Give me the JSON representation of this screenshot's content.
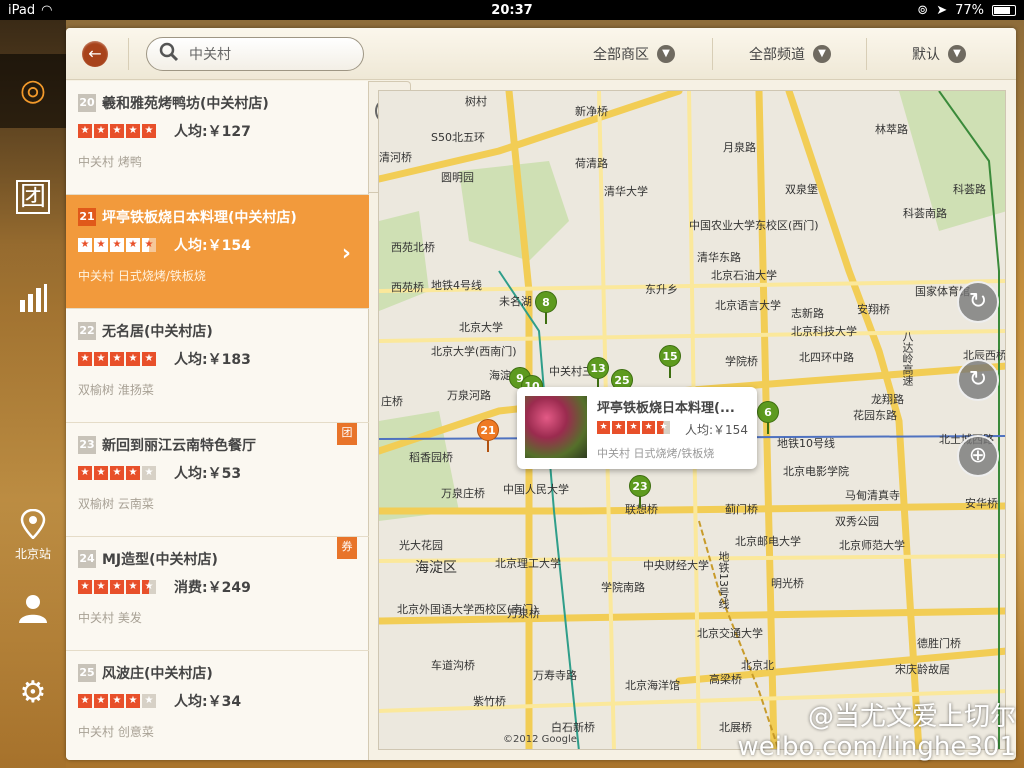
{
  "status": {
    "device": "iPad",
    "time": "20:37",
    "battery": "77%"
  },
  "rail": {
    "items": [
      {
        "icon": "search-map-icon",
        "glyph": "◎",
        "label": ""
      },
      {
        "icon": "group-buy-icon",
        "glyph": "团",
        "label": ""
      },
      {
        "icon": "chart-icon",
        "glyph": "▮",
        "label": ""
      },
      {
        "icon": "location-pin-icon",
        "glyph": "⌾",
        "label": "北京站"
      },
      {
        "icon": "user-icon",
        "glyph": "☻",
        "label": ""
      },
      {
        "icon": "gear-icon",
        "glyph": "⚙",
        "label": ""
      }
    ]
  },
  "topbar": {
    "search_value": "中关村",
    "filters": [
      "全部商区",
      "全部频道",
      "默认"
    ]
  },
  "list": [
    {
      "num": "20",
      "name": "羲和雅苑烤鸭坊(中关村店)",
      "stars": 5,
      "price": "人均:￥127",
      "tags": "中关村  烤鸭",
      "badge": ""
    },
    {
      "num": "21",
      "name": "坪亭铁板烧日本料理(中关村店)",
      "stars": 4.5,
      "price": "人均:￥154",
      "tags": "中关村  日式烧烤/铁板烧",
      "badge": ""
    },
    {
      "num": "22",
      "name": "无名居(中关村店)",
      "stars": 5,
      "price": "人均:￥183",
      "tags": "双榆树  淮扬菜",
      "badge": ""
    },
    {
      "num": "23",
      "name": "新回到丽江云南特色餐厅",
      "stars": 4,
      "price": "人均:￥53",
      "tags": "双榆树  云南菜",
      "badge": "团"
    },
    {
      "num": "24",
      "name": "MJ造型(中关村店)",
      "stars": 4.5,
      "price": "消费:￥249",
      "tags": "中关村  美发",
      "badge": "券"
    },
    {
      "num": "25",
      "name": "风波庄(中关村店)",
      "stars": 4,
      "price": "人均:￥34",
      "tags": "中关村  创意菜",
      "badge": ""
    }
  ],
  "map": {
    "labels": [
      "树村",
      "新净桥",
      "S50北五环",
      "圆明园",
      "清河桥",
      "荷清路",
      "清华大学",
      "月泉路",
      "双泉堡",
      "林萃路",
      "科荟路",
      "西苑北桥",
      "中国农业大学东校区(西门)",
      "清华东路",
      "科荟南路",
      "西苑桥",
      "地铁4号线",
      "未名湖",
      "东升乡",
      "北京石油大学",
      "北京语言大学",
      "北京大学",
      "志新路",
      "安翔桥",
      "国家体育馆",
      "北京大学(西南门)",
      "中关村三",
      "学院桥",
      "北四环中路",
      "北辰西桥",
      "海淀",
      "北京科技大学",
      "花园东路",
      "龙翔路",
      "庄桥",
      "万泉河路",
      "地铁10号线",
      "北土城西路",
      "稻香园桥",
      "中国人民大学",
      "北京电影学院",
      "马甸清真寺",
      "安华桥",
      "万泉庄桥",
      "联想桥",
      "蓟门桥",
      "双秀公园",
      "光大花园",
      "海淀区",
      "北京理工大学",
      "中央财经大学",
      "北京邮电大学",
      "北京师范大学",
      "明光桥",
      "北京外国语大学西校区(南门)",
      "万泉桥",
      "学院南路",
      "北京交通大学",
      "德胜门桥",
      "车道沟桥",
      "紫竹桥",
      "万寿寺路",
      "北京海洋馆",
      "高梁桥",
      "北京北",
      "白石新桥",
      "北展桥",
      "宋庆龄故居",
      "八达岭高速",
      "地铁13号线"
    ],
    "pins": [
      "8",
      "13",
      "9",
      "10",
      "25",
      "15",
      "6",
      "21",
      "23"
    ],
    "copyright": "©2012 Google",
    "popup": {
      "name": "坪亭铁板烧日本料理(...",
      "stars": 4.5,
      "price": "人均:￥154",
      "tags": "中关村  日式烧烤/铁板烧"
    }
  },
  "watermark": {
    "line1": "@当尤文爱上切尔",
    "line2": "weibo.com/linghe301"
  }
}
